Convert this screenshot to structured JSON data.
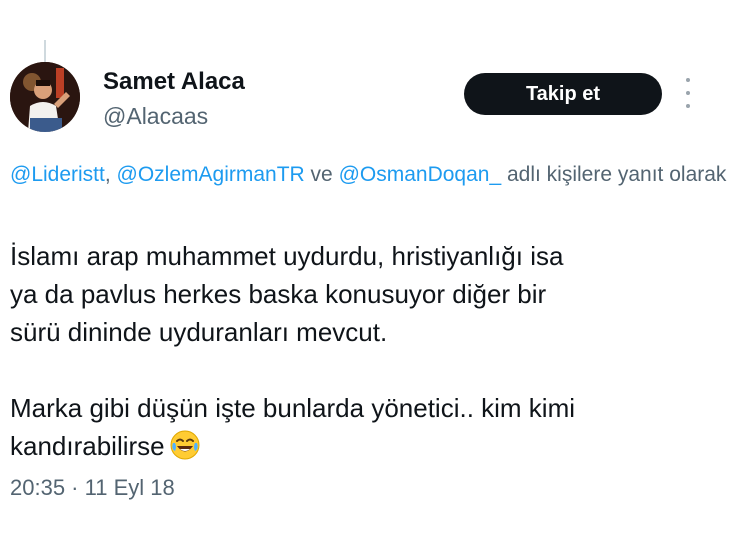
{
  "author": {
    "name": "Samet Alaca",
    "handle": "@Alacaas"
  },
  "follow_button": {
    "label": "Takip et"
  },
  "reply_context": {
    "mentions": [
      "@Lideristt",
      "@OzlemAgirmanTR",
      "@OsmanDoqan_"
    ],
    "separator": ", ",
    "conjunction": " ve ",
    "suffix": " adlı kişilere yanıt olarak"
  },
  "tweet": {
    "lines": [
      "İslamı arap muhammet uydurdu, hristiyanlığı isa",
      "ya da pavlus herkes baska konusuyor diğer bir",
      "sürü dininde uyduranları mevcut."
    ],
    "lines2": [
      "Marka gibi düşün işte bunlarda yönetici.. kim kimi",
      "kandırabilirse"
    ],
    "emoji": "face-with-tears-of-joy-icon"
  },
  "timestamp": {
    "time": "20:35",
    "separator": " · ",
    "date": "11 Eyl 18"
  },
  "colors": {
    "text": "#0f1419",
    "secondary": "#536471",
    "link": "#1d9bf0",
    "button_bg": "#0f1419"
  }
}
